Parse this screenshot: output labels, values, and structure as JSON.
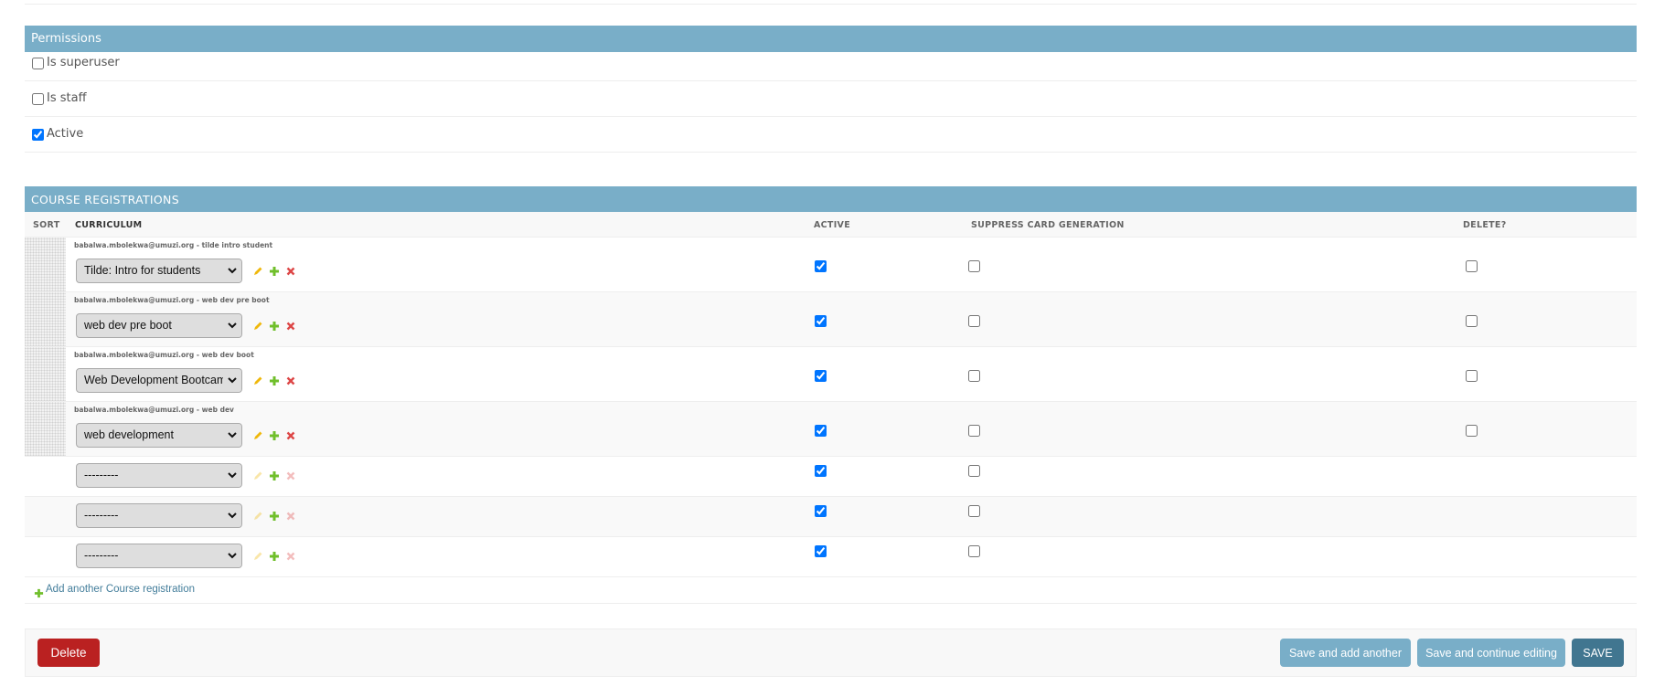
{
  "permissions": {
    "header": "Permissions",
    "fields": [
      {
        "label": "Is superuser",
        "checked": false
      },
      {
        "label": "Is staff",
        "checked": false
      },
      {
        "label": "Active",
        "checked": true
      }
    ]
  },
  "registrations": {
    "header": "Course Registrations",
    "columns": {
      "sort": "Sort",
      "curriculum": "Curriculum",
      "active": "Active",
      "suppress": "Suppress card generation",
      "delete": "Delete?"
    },
    "rows": [
      {
        "original": "babalwa.mbolekwa@umuzi.org - tilde intro student",
        "selected": "Tilde: Intro for students",
        "active": true,
        "suppress": false,
        "delete": false
      },
      {
        "original": "babalwa.mbolekwa@umuzi.org - web dev pre boot",
        "selected": "web dev pre boot",
        "active": true,
        "suppress": false,
        "delete": false
      },
      {
        "original": "babalwa.mbolekwa@umuzi.org - web dev boot",
        "selected": "Web Development Bootcamp",
        "active": true,
        "suppress": false,
        "delete": false
      },
      {
        "original": "babalwa.mbolekwa@umuzi.org - web dev",
        "selected": "web development",
        "active": true,
        "suppress": false,
        "delete": false
      }
    ],
    "extra_rows": [
      {
        "selected": "---------",
        "active": true,
        "suppress": false
      },
      {
        "selected": "---------",
        "active": true,
        "suppress": false
      },
      {
        "selected": "---------",
        "active": true,
        "suppress": false
      }
    ],
    "add_another": "Add another Course registration"
  },
  "actions": {
    "delete": "Delete",
    "save_add": "Save and add another",
    "save_continue": "Save and continue editing",
    "save": "SAVE"
  },
  "colors": {
    "header_bg": "#79aec8",
    "delete_btn": "#ba2121",
    "save_btn": "#417690",
    "link": "#447e9b",
    "edit_icon": "#efb80b",
    "add_icon": "#70bf2b",
    "delete_icon": "#dd4646"
  },
  "icons": {
    "edit": "pencil-icon",
    "add": "plus-icon",
    "delete": "x-icon",
    "select": "chevron-down-icon"
  }
}
